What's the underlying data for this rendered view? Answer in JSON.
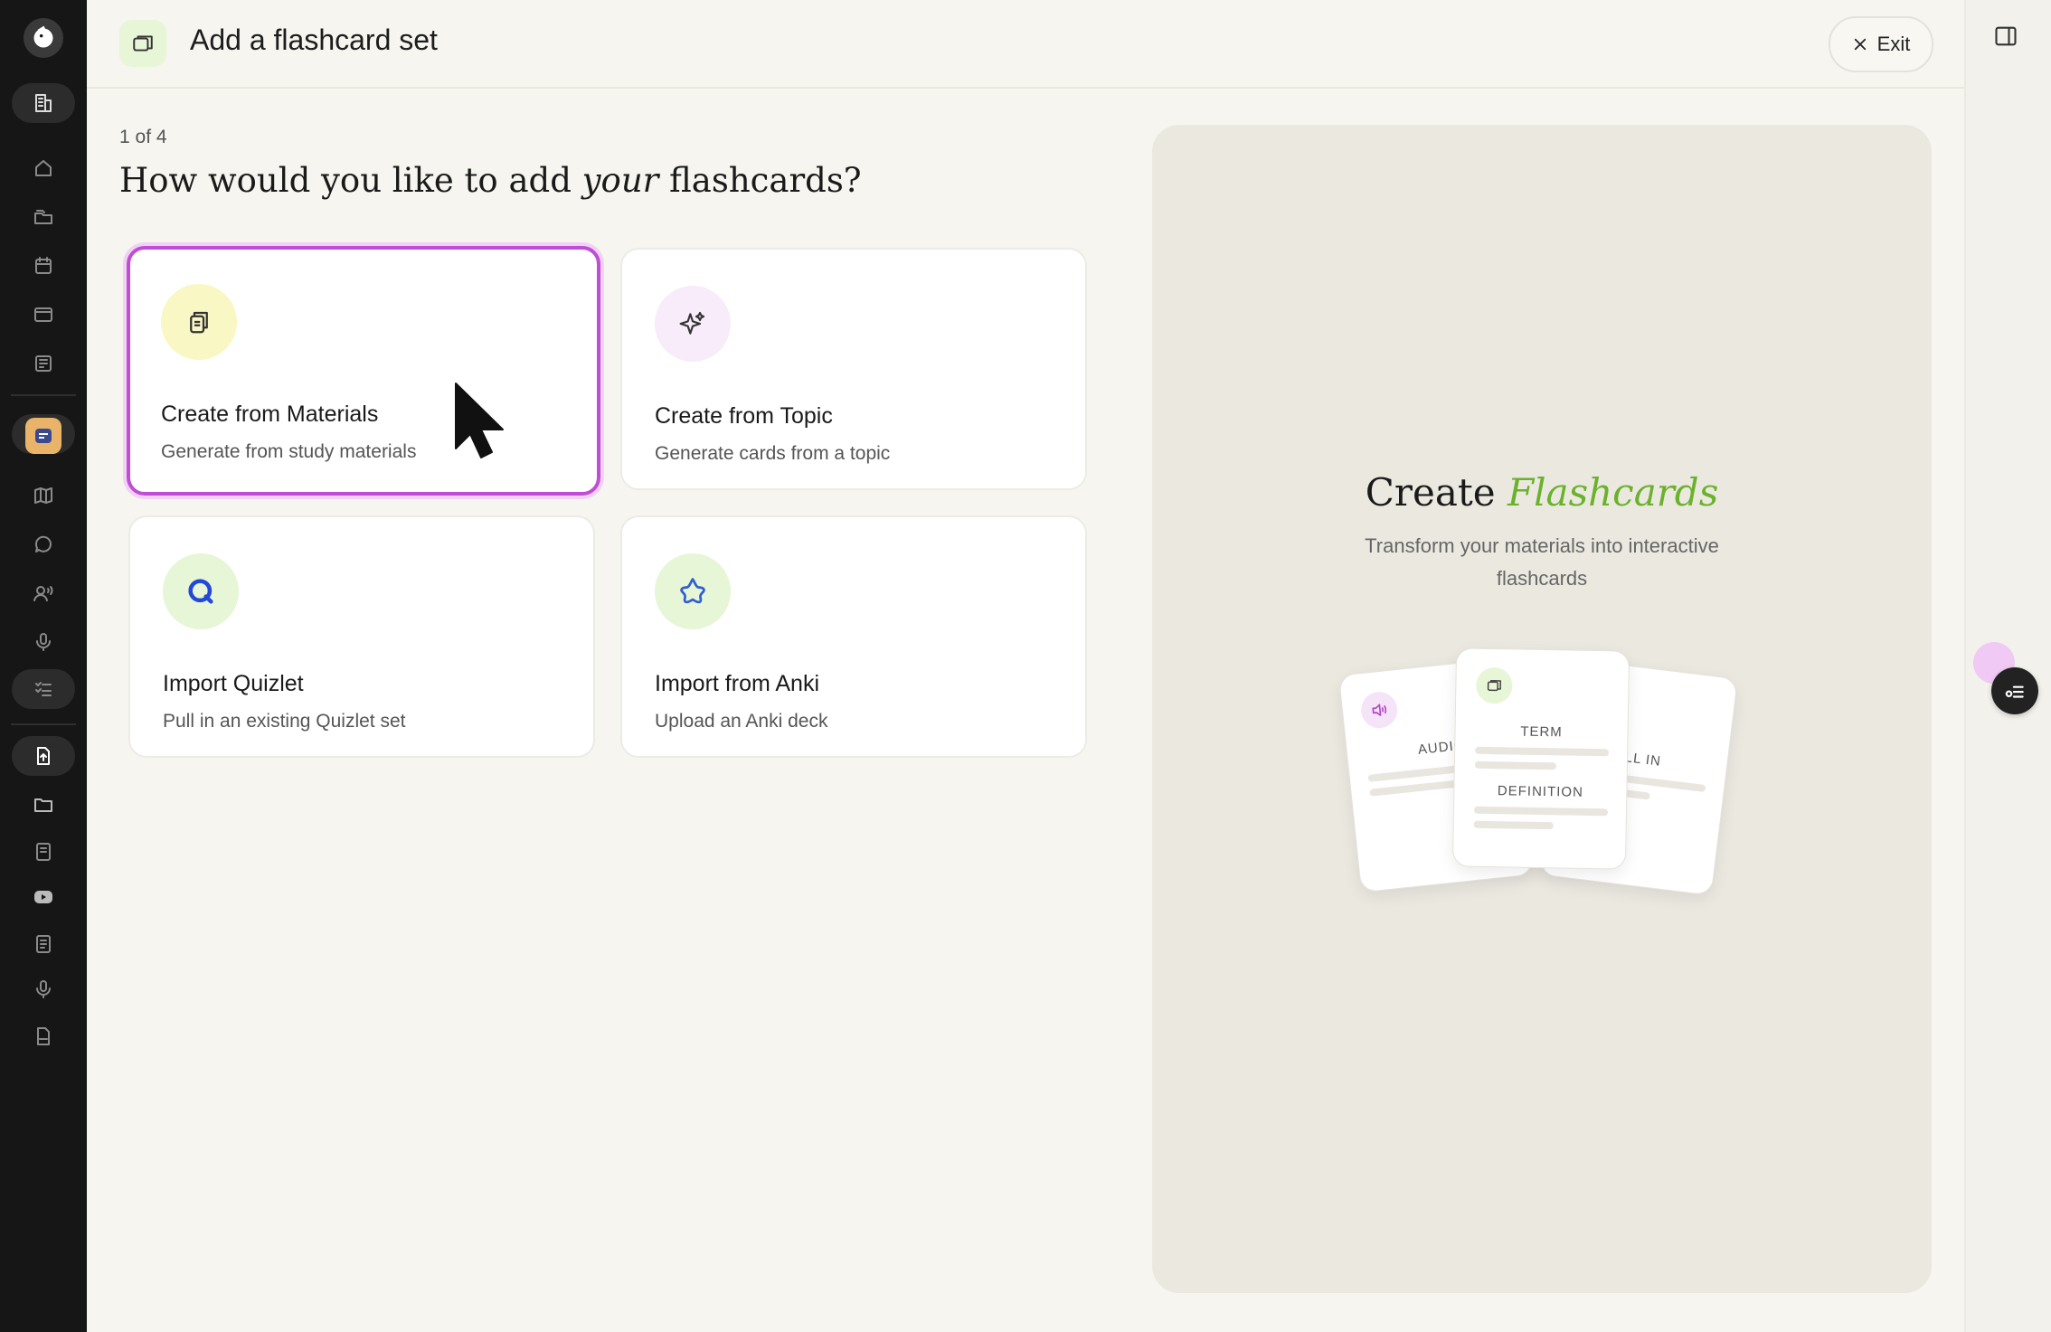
{
  "header": {
    "title": "Add a flashcard set",
    "exit_label": "Exit"
  },
  "main": {
    "step": "1 of 4",
    "question_before": "How would you like to add ",
    "question_emphasis": "your",
    "question_after": " flashcards?",
    "options": [
      {
        "title": "Create from Materials",
        "subtitle": "Generate from study materials",
        "icon": "document-copy-icon",
        "selected": true
      },
      {
        "title": "Create from Topic",
        "subtitle": "Generate cards from a topic",
        "icon": "sparkle-icon",
        "selected": false
      },
      {
        "title": "Import Quizlet",
        "subtitle": "Pull in an existing Quizlet set",
        "icon": "quizlet-icon",
        "selected": false
      },
      {
        "title": "Import from Anki",
        "subtitle": "Upload an Anki deck",
        "icon": "anki-star-icon",
        "selected": false
      }
    ]
  },
  "preview": {
    "title_plain": "Create ",
    "title_emphasis": "Flashcards",
    "subtitle": "Transform your materials into interactive flashcards",
    "cards": {
      "audio_label": "AUDIO",
      "term_label": "TERM",
      "definition_label": "DEFINITION",
      "fill_label": "FILL IN"
    }
  },
  "colors": {
    "selected_border": "#c04dd6",
    "accent_green": "#6bb22c",
    "sidebar_bg": "#161616"
  }
}
